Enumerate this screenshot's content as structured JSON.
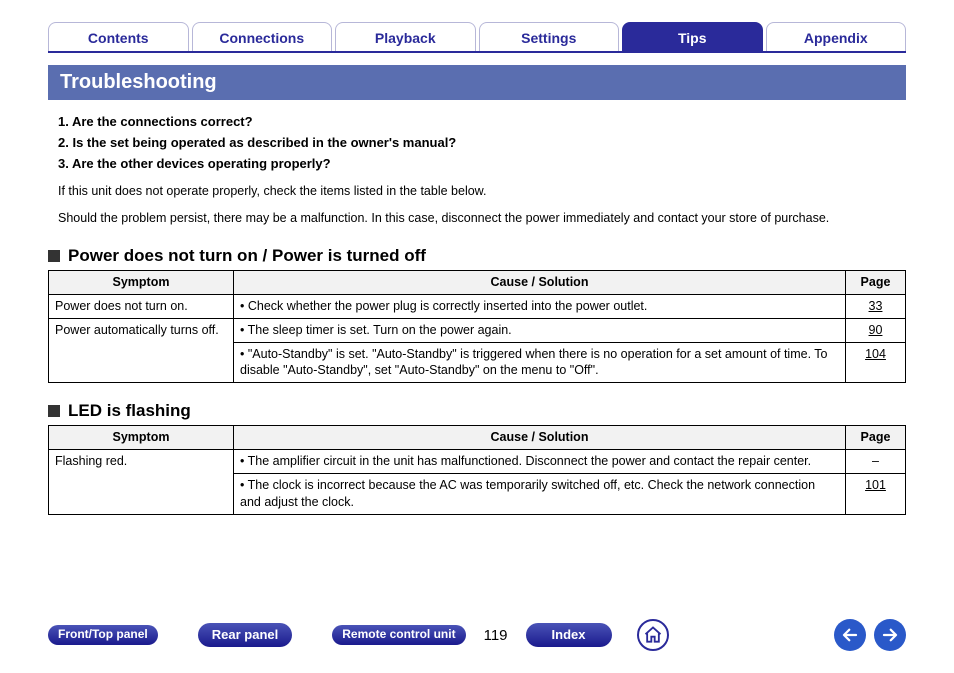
{
  "tabs": {
    "contents": "Contents",
    "connections": "Connections",
    "playback": "Playback",
    "settings": "Settings",
    "tips": "Tips",
    "appendix": "Appendix"
  },
  "title": "Troubleshooting",
  "checklist": {
    "q1": "1.  Are the connections correct?",
    "q2": "2.  Is the set being operated as described in the owner's manual?",
    "q3": "3.  Are the other devices operating properly?"
  },
  "intro1": "If this unit does not operate properly, check the items listed in the table below.",
  "intro2": "Should the problem persist, there may be a malfunction. In this case, disconnect the power immediately and contact your store of purchase.",
  "section1": {
    "heading": "Power does not turn on / Power is turned off",
    "headers": {
      "symptom": "Symptom",
      "cause": "Cause / Solution",
      "page": "Page"
    },
    "rows": [
      {
        "symptom": "Power does not turn on.",
        "cause": "Check whether the power plug is correctly inserted into the power outlet.",
        "page": "33"
      },
      {
        "symptom": "Power automatically turns off.",
        "cause": "The sleep timer is set. Turn on the power again.",
        "page": "90"
      },
      {
        "symptom": "",
        "cause": "\"Auto-Standby\" is set. \"Auto-Standby\" is triggered when there is no operation for a set amount of time. To disable \"Auto-Standby\", set \"Auto-Standby\" on the menu to \"Off\".",
        "page": "104"
      }
    ]
  },
  "section2": {
    "heading": "LED is flashing",
    "headers": {
      "symptom": "Symptom",
      "cause": "Cause / Solution",
      "page": "Page"
    },
    "rows": [
      {
        "symptom": "Flashing red.",
        "cause": "The amplifier circuit in the unit has malfunctioned. Disconnect the power and contact the repair center.",
        "page": "–"
      },
      {
        "symptom": "",
        "cause": "The clock is incorrect because the AC was temporarily switched off, etc. Check the network connection and adjust the clock.",
        "page": "101"
      }
    ]
  },
  "bottom": {
    "front_top": "Front/Top panel",
    "rear_panel": "Rear panel",
    "remote": "Remote control unit",
    "index": "Index",
    "page_number": "119"
  }
}
